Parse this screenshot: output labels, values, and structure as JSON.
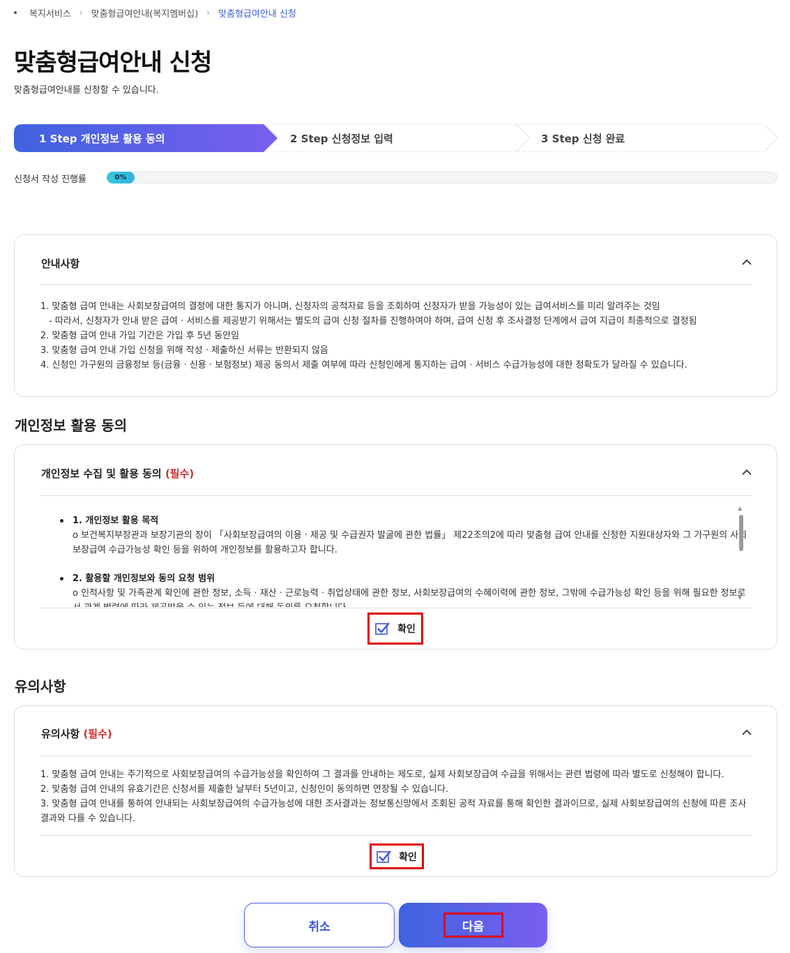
{
  "breadcrumb": {
    "items": [
      "복지서비스",
      "맞춤형급여안내(복지멤버십)"
    ],
    "current": "맞춤형급여안내 신청"
  },
  "page": {
    "title": "맞춤형급여안내 신청",
    "subtitle": "맞춤형급여안내를 신청할 수 있습니다."
  },
  "steps": [
    {
      "label": "1 Step 개인정보 활용 동의",
      "active": true
    },
    {
      "label": "2 Step 신청정보 입력",
      "active": false
    },
    {
      "label": "3 Step 신청 완료",
      "active": false
    }
  ],
  "progress": {
    "label": "신청서 작성 진행률",
    "value_text": "0%",
    "value": 0
  },
  "notice": {
    "title": "안내사항",
    "lines": [
      "1. 맞춤형 급여 안내는 사회보장급여의 결정에 대한 통지가 아니며, 신청자의 공적자료 등을 조회하여 신청자가 받을 가능성이 있는 급여서비스를 미리 알려주는 것임",
      "- 따라서, 신청자가 안내 받은 급여 · 서비스를 제공받기 위해서는 별도의 급여 신청 절차를 진행하여야 하며, 급여 신청 후 조사결정 단계에서 급여 지급이 최종적으로 결정됨",
      "2. 맞춤형 급여 안내 가입 기간은 가입 후 5년 동안임",
      "3. 맞춤형 급여 안내 가입 신청을 위해 작성 · 제출하신 서류는 반환되지 않음",
      "4. 신청인 가구원의 금융정보 등(금융 · 신용 · 보험정보) 제공 동의서 제출 여부에 따라 신청인에게 통지하는 급여 · 서비스 수급가능성에 대한 정확도가 달라질 수 있습니다."
    ]
  },
  "consent_section": {
    "title": "개인정보 활용 동의",
    "panel_title": "개인정보 수집 및 활용 동의",
    "required": "(필수)",
    "items": [
      {
        "head": "1. 개인정보 활용 목적",
        "body": "o 보건복지부장관과 보장기관의 장이 「사회보장급여의 이용 · 제공 및 수급권자 발굴에 관한 법률」 제22조의2에 따라 맞춤형 급여 안내를 신청한 지원대상자와 그 가구원의 사회보장급여 수급가능성 확인 등을 위하여 개인정보를 활용하고자 합니다."
      },
      {
        "head": "2. 활용할 개인정보와 동의 요청 범위",
        "body": "o 인적사항 및 가족관계 확인에 관한 정보, 소득 · 재산 · 근로능력 · 취업상태에 관한 정보, 사회보장급여의 수혜이력에 관한 정보, 그밖에 수급가능성 확인 등을 위해 필요한 정보로서 관계 법령에 따라 제공받을 수 있는 정보 등에 대해 동의를 요청합니다."
      }
    ],
    "confirm_label": "확인",
    "checked": true
  },
  "caution_section": {
    "title": "유의사항",
    "panel_title": "유의사항",
    "required": "(필수)",
    "lines": [
      "1. 맞춤형 급여 안내는 주기적으로 사회보장급여의 수급가능성을 확인하여 그 결과를 안내하는 제도로, 실제 사회보장급여 수급을 위해서는 관련 법령에 따라 별도로 신청해야 합니다.",
      "2. 맞춤형 급여 안내의 유효기간은 신청서를 제출한 날부터 5년이고, 신청인이 동의하면 연장될 수 있습니다.",
      "3. 맞춤형 급여 안내를 통하여 안내되는 사회보장급여의 수급가능성에 대한 조사결과는 정보통신망에서 조회된 공적 자료를 통해 확인한 결과이므로, 실제 사회보장급여의 신청에 따른 조사결과와 다를 수 있습니다."
    ],
    "confirm_label": "확인",
    "checked": true
  },
  "buttons": {
    "cancel": "취소",
    "next": "다음"
  },
  "colors": {
    "accent": "#4b63e0",
    "accent_gradient_end": "#7a5ef0",
    "required": "#d32f2f",
    "highlight_box": "#e10000",
    "progress": "#3bc5d9"
  }
}
